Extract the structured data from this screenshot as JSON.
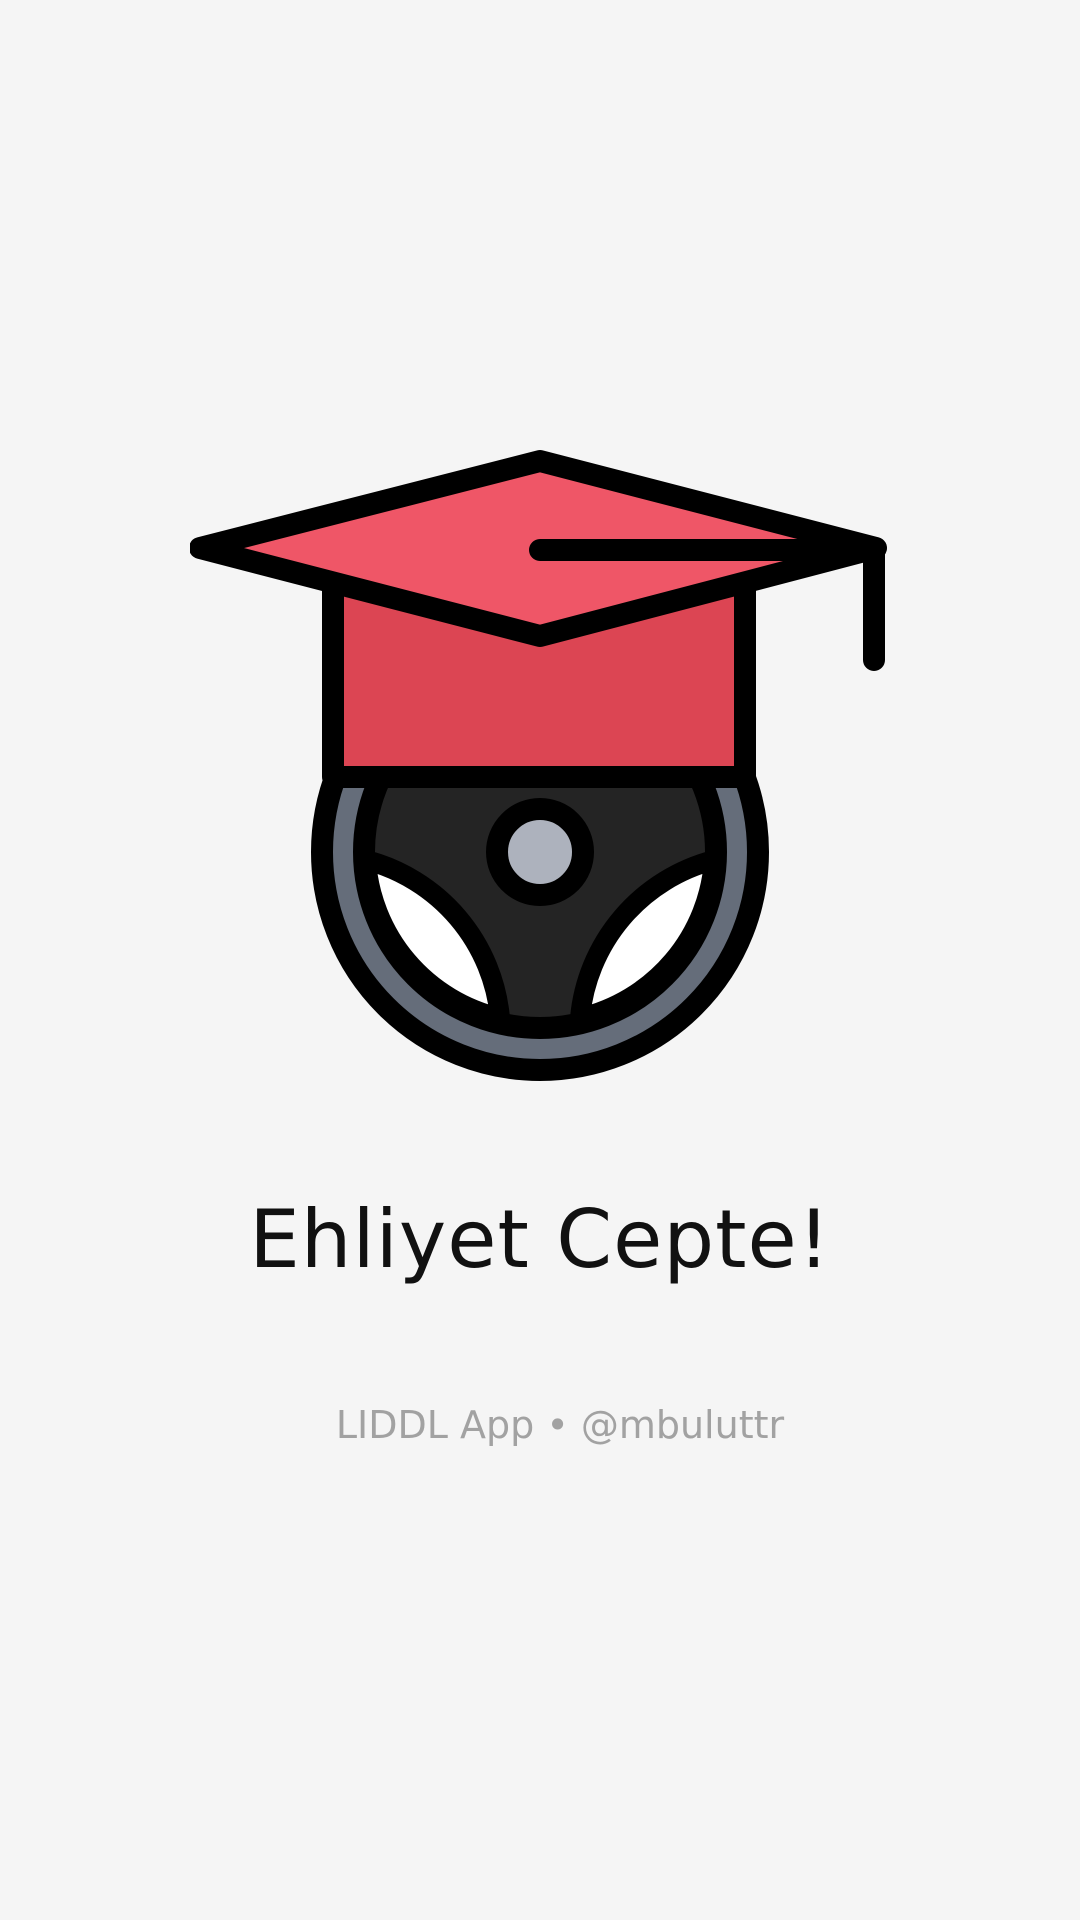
{
  "splash": {
    "logo_icon": "graduation-cap-steering-wheel-icon",
    "title": "Ehliyet Cepte!",
    "credits": "LIDDL App • @mbuluttr"
  },
  "colors": {
    "background": "#f5f5f5",
    "cap_top": "#ef5667",
    "cap_band": "#dc4553",
    "wheel_rim": "#656d7a",
    "wheel_inner": "#242424",
    "wheel_hub": "#adb2bd",
    "outline": "#000000"
  }
}
